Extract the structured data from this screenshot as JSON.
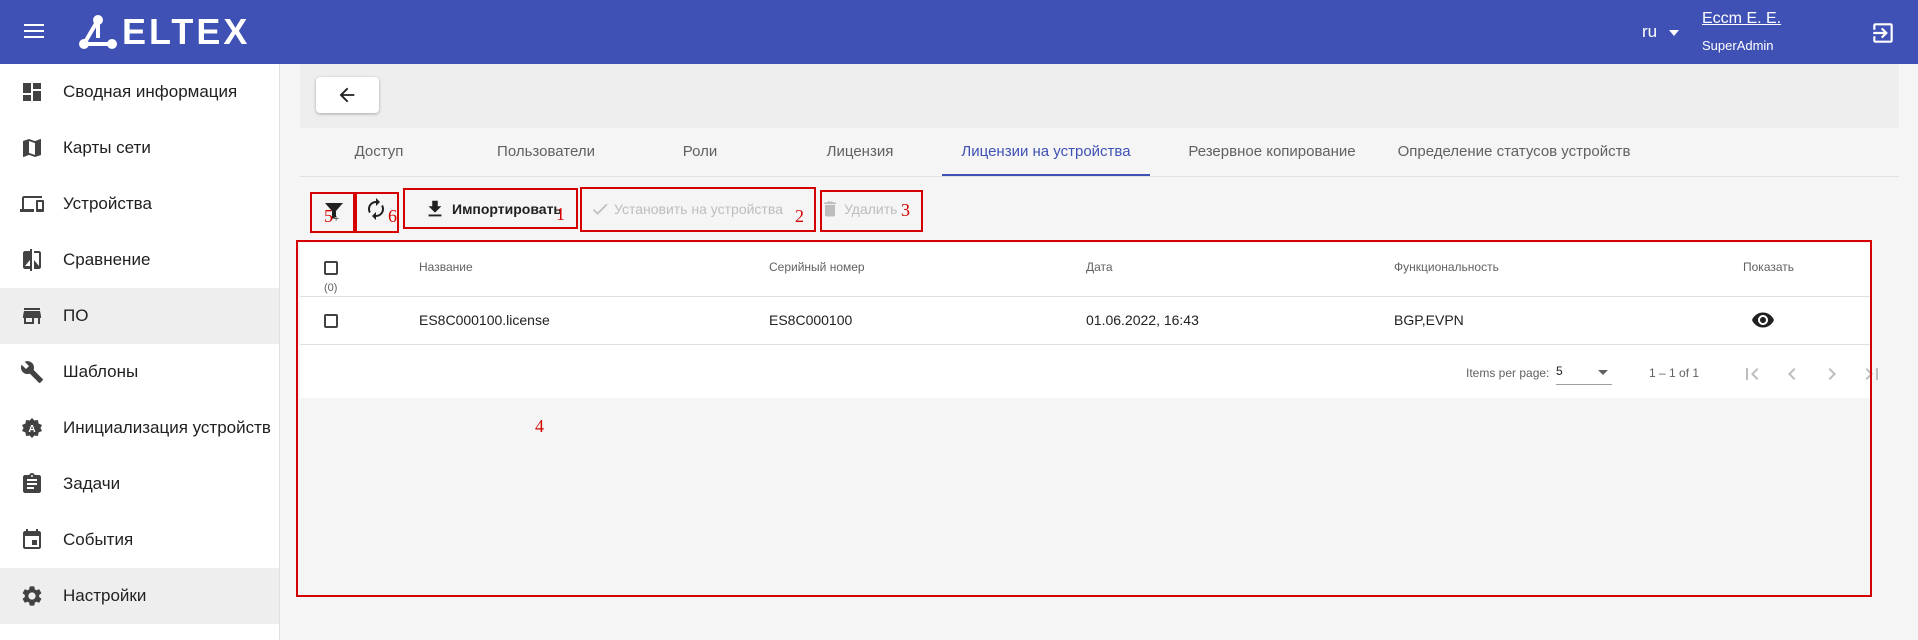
{
  "header": {
    "logo": "ELTEX",
    "lang": "ru",
    "user_name": "Eccm E. E.",
    "user_role": "SuperAdmin"
  },
  "sidebar": {
    "items": [
      {
        "label": "Сводная информация",
        "icon": "dashboard-icon"
      },
      {
        "label": "Карты сети",
        "icon": "map-icon"
      },
      {
        "label": "Устройства",
        "icon": "devices-icon"
      },
      {
        "label": "Сравнение",
        "icon": "compare-icon"
      },
      {
        "label": "ПО",
        "icon": "store-icon"
      },
      {
        "label": "Шаблоны",
        "icon": "wrench-icon"
      },
      {
        "label": "Инициализация устройств",
        "icon": "init-icon"
      },
      {
        "label": "Задачи",
        "icon": "clipboard-icon"
      },
      {
        "label": "События",
        "icon": "calendar-icon"
      },
      {
        "label": "Настройки",
        "icon": "gear-icon"
      }
    ]
  },
  "tabs": [
    {
      "label": "Доступ"
    },
    {
      "label": "Пользователи"
    },
    {
      "label": "Роли"
    },
    {
      "label": "Лицензия"
    },
    {
      "label": "Лицензии на устройства",
      "active": true
    },
    {
      "label": "Резервное копирование"
    },
    {
      "label": "Определение статусов устройств"
    }
  ],
  "toolbar": {
    "import_label": "Импортировать",
    "install_label": "Установить на устройства",
    "delete_label": "Удалить"
  },
  "annotations": {
    "n1": "1",
    "n2": "2",
    "n3": "3",
    "n4": "4",
    "n5": "5",
    "n5_sub": "+",
    "n6": "6"
  },
  "table": {
    "selected_count": "(0)",
    "columns": [
      "Название",
      "Серийный номер",
      "Дата",
      "Функциональность",
      "Показать"
    ],
    "rows": [
      {
        "name": "ES8C000100.license",
        "serial": "ES8C000100",
        "date": "01.06.2022, 16:43",
        "features": "BGP,EVPN"
      }
    ]
  },
  "pagination": {
    "items_per_page_label": "Items per page:",
    "page_size": "5",
    "range": "1 – 1 of 1"
  },
  "colors": {
    "header": "#3f51b5",
    "accent": "#3f51b5",
    "annotation": "#d50000"
  }
}
